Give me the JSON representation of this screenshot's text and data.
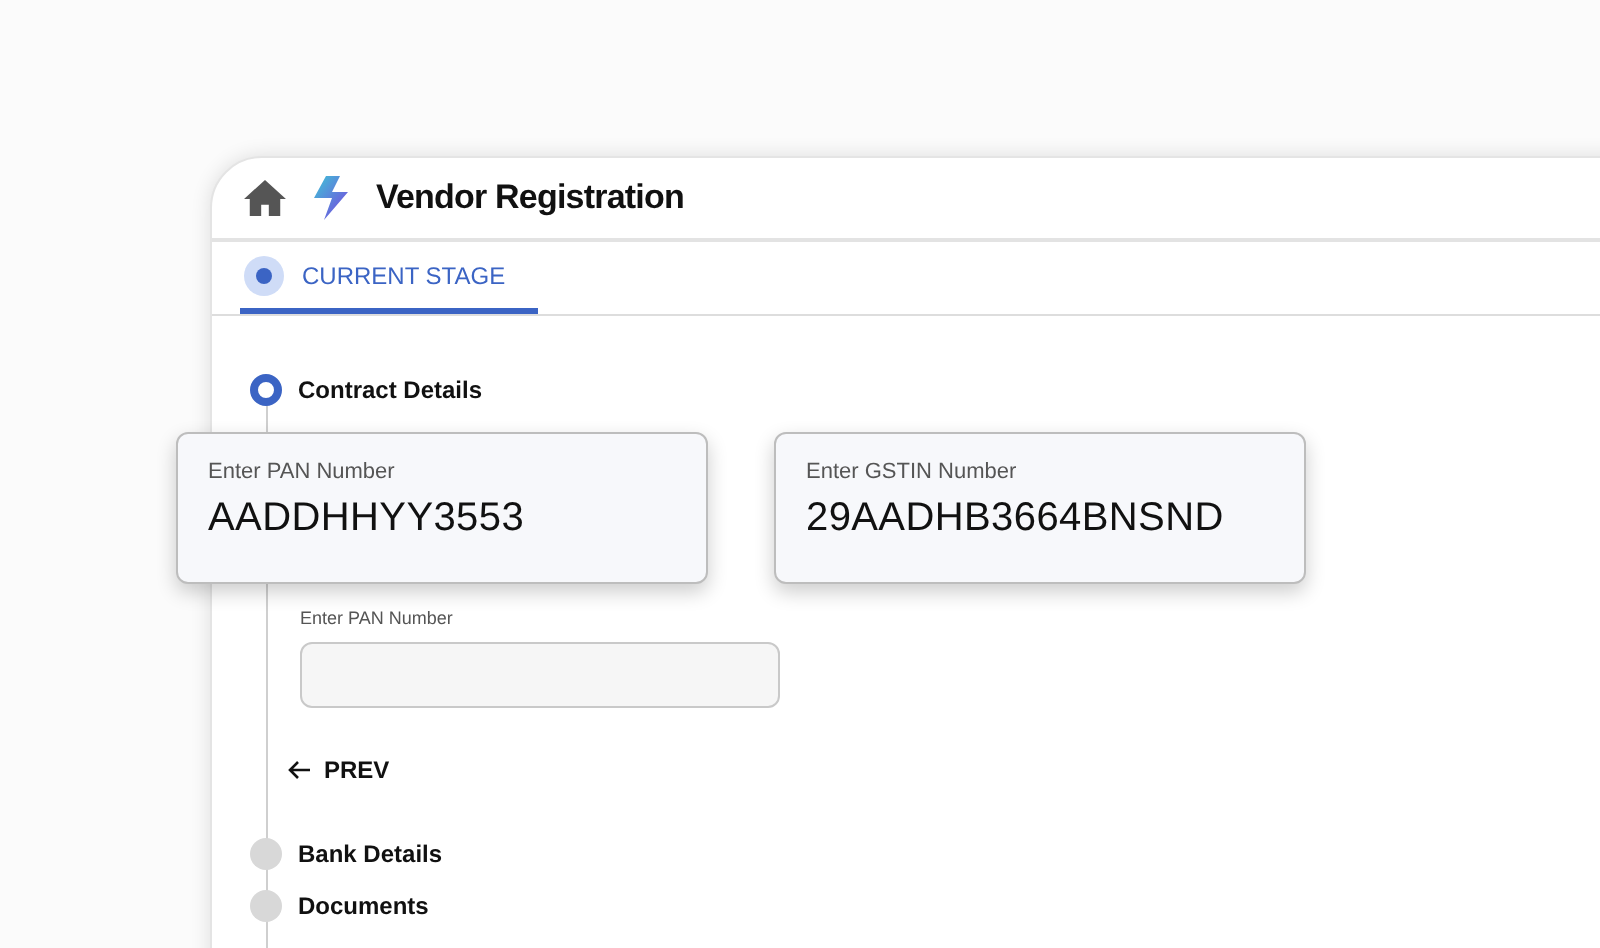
{
  "header": {
    "title": "Vendor Registration"
  },
  "tabs": [
    {
      "label": "CURRENT STAGE",
      "selected": true
    }
  ],
  "steps": [
    {
      "label": "Contract Details",
      "active": true,
      "form": {
        "field_label": "Enter PAN Number",
        "prev_button": "PREV"
      }
    },
    {
      "label": "Bank Details",
      "active": false
    },
    {
      "label": "Documents",
      "active": false
    }
  ],
  "floating_fields": [
    {
      "label": "Enter PAN Number",
      "value": "AADDHHYY3553"
    },
    {
      "label": "Enter GSTIN Number",
      "value": "29AADHB3664BNSND"
    }
  ]
}
